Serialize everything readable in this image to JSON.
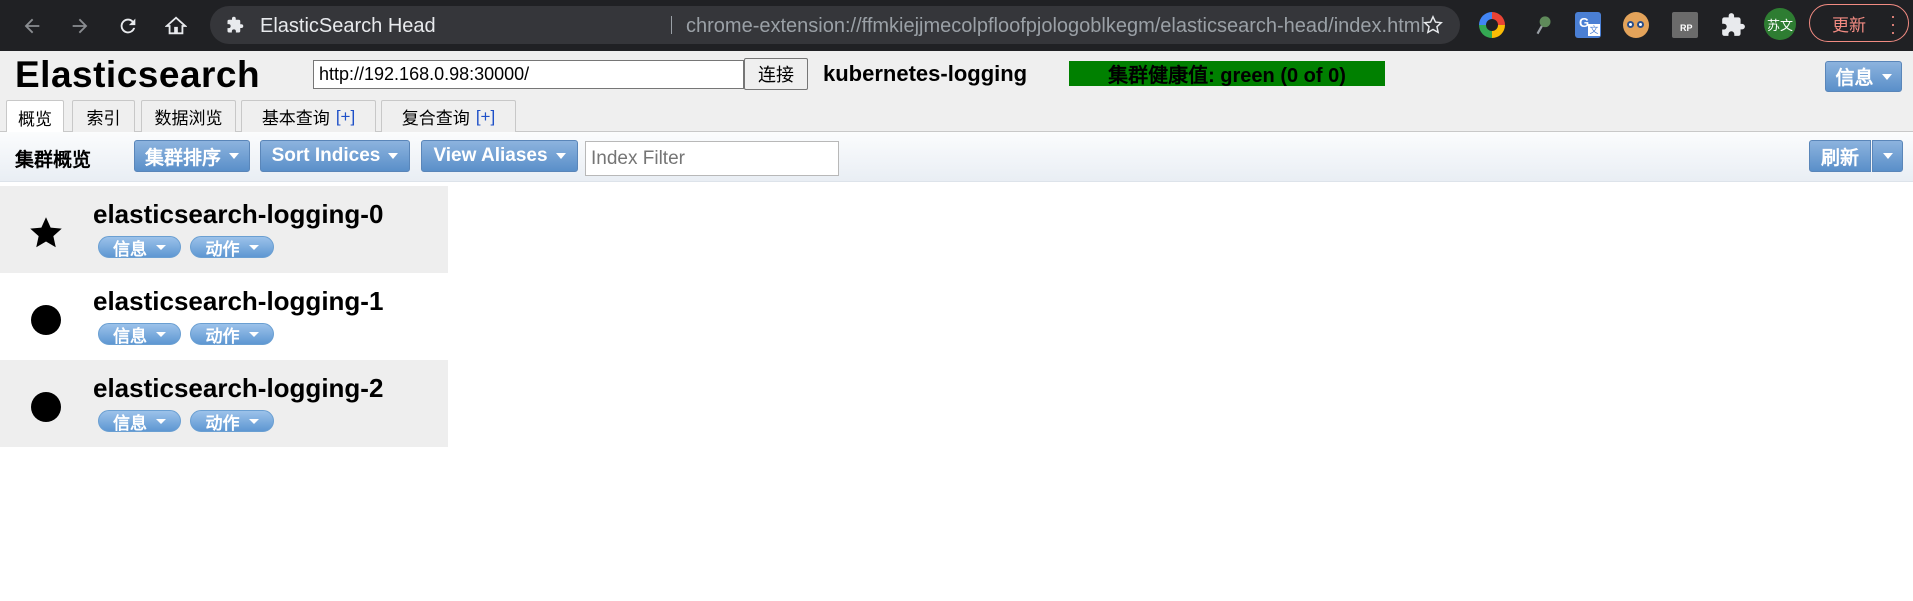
{
  "browser": {
    "tab_title": "ElasticSearch Head",
    "url": "chrome-extension://ffmkiejjmecolpfloofpjologoblkegm/elasticsearch-head/index.html",
    "profile_label": "苏文",
    "update_label": "更新"
  },
  "header": {
    "app_title": "Elasticsearch",
    "connection_url": "http://192.168.0.98:30000/",
    "connect_label": "连接",
    "cluster_name": "kubernetes-logging",
    "health_text": "集群健康值: green (0 of 0)",
    "health_color": "#008000",
    "info_label": "信息"
  },
  "tabs": [
    {
      "label": "概览",
      "plus": ""
    },
    {
      "label": "索引",
      "plus": ""
    },
    {
      "label": "数据浏览",
      "plus": ""
    },
    {
      "label": "基本查询",
      "plus": "[+]"
    },
    {
      "label": "复合查询",
      "plus": "[+]"
    }
  ],
  "toolbar": {
    "title": "集群概览",
    "sort_cluster_label": "集群排序",
    "sort_indices_label": "Sort Indices",
    "view_aliases_label": "View Aliases",
    "filter_placeholder": "Index Filter",
    "refresh_label": "刷新"
  },
  "nodes": [
    {
      "name": "elasticsearch-logging-0",
      "icon": "star-icon",
      "info_label": "信息",
      "action_label": "动作"
    },
    {
      "name": "elasticsearch-logging-1",
      "icon": "circle-icon",
      "info_label": "信息",
      "action_label": "动作"
    },
    {
      "name": "elasticsearch-logging-2",
      "icon": "circle-icon",
      "info_label": "信息",
      "action_label": "动作"
    }
  ]
}
